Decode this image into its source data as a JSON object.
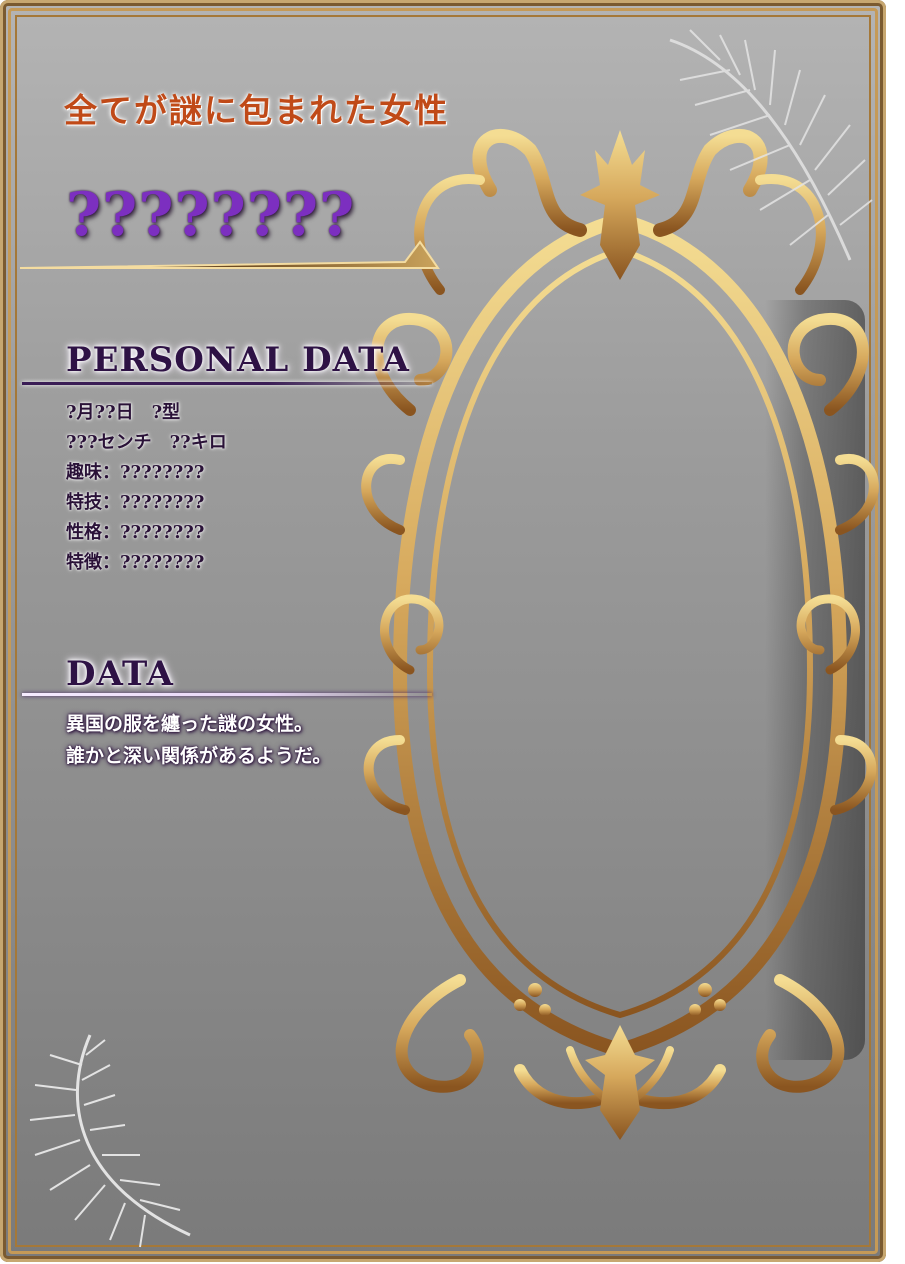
{
  "card": {
    "subtitle": "全てが謎に包まれた女性",
    "name": "????????",
    "personal_heading": "PERSONAL DATA",
    "personal_lines": [
      "?月??日　?型",
      "???センチ　??キロ",
      "趣味：????????",
      "特技：????????",
      "性格：????????",
      "特徴：????????"
    ],
    "data_heading": "DATA",
    "data_lines": [
      "異国の服を纏った謎の女性。",
      "誰かと深い関係があるようだ。"
    ]
  },
  "colors": {
    "subtitle": "#c04a18",
    "name": "#7c2fc0",
    "frame_gold": "#c59a57",
    "ornament_light": "#f0d58a",
    "ornament_dark": "#8a5520"
  },
  "decor": {
    "ornament": "gold-frame-ornament",
    "top_feather": "feather-icon",
    "bottom_feather": "feather-icon"
  }
}
